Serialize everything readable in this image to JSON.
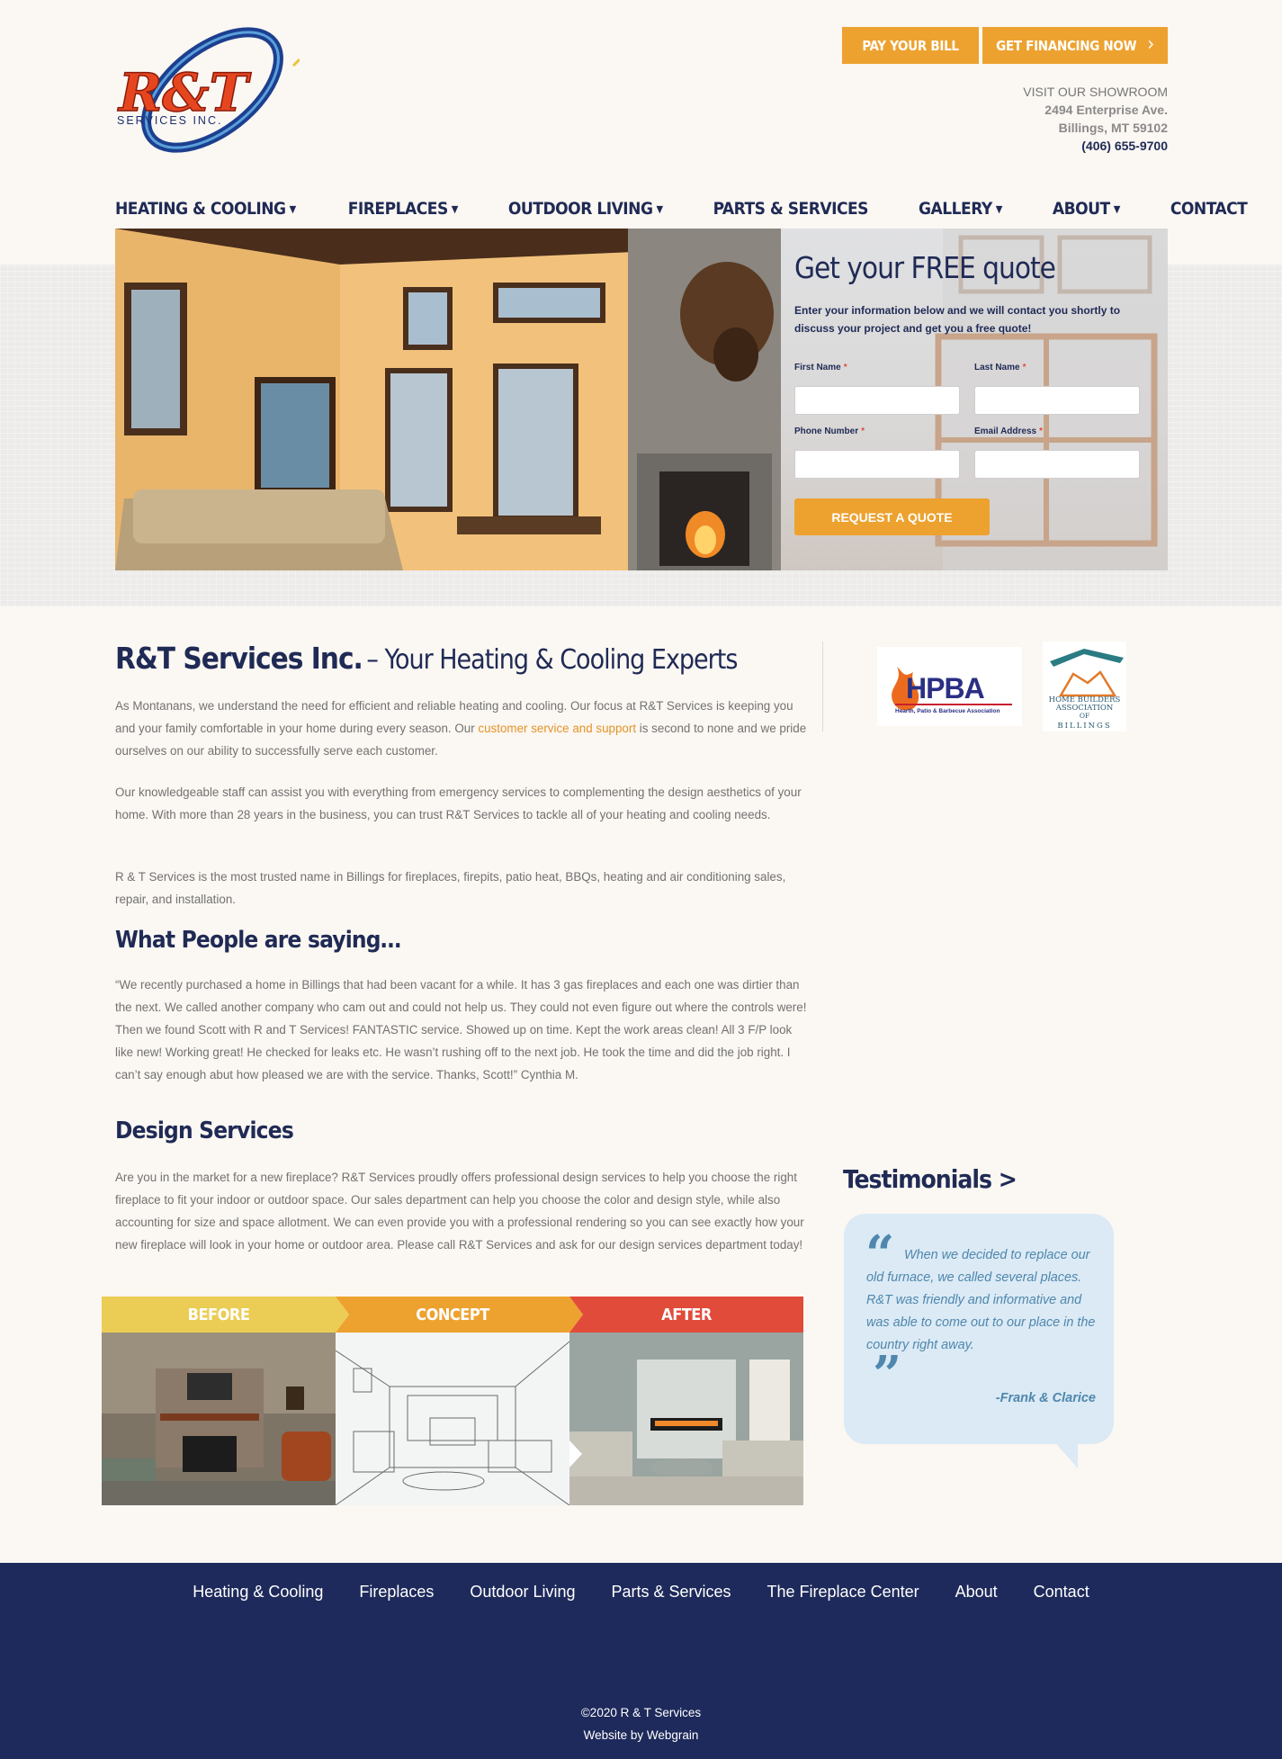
{
  "header": {
    "logo_text": "R&T",
    "logo_subtext": "SERVICES INC.",
    "pay_bill_label": "PAY YOUR BILL",
    "financing_label": "GET FINANCING NOW",
    "showroom": {
      "heading": "VISIT OUR SHOWROOM",
      "street": "2494 Enterprise Ave.",
      "city": "Billings, MT 59102",
      "phone": "(406) 655-9700"
    }
  },
  "nav": {
    "items": [
      {
        "label": "HEATING & COOLING",
        "dropdown": true
      },
      {
        "label": "FIREPLACES",
        "dropdown": true
      },
      {
        "label": "OUTDOOR LIVING",
        "dropdown": true
      },
      {
        "label": "PARTS & SERVICES",
        "dropdown": false
      },
      {
        "label": "GALLERY",
        "dropdown": true
      },
      {
        "label": "ABOUT",
        "dropdown": true
      },
      {
        "label": "CONTACT",
        "dropdown": false
      }
    ]
  },
  "quote_form": {
    "title": "Get your FREE quote",
    "description": "Enter your information below and we will contact you shortly to discuss your project and get you a free quote!",
    "fields": {
      "first_name": "First Name",
      "last_name": "Last Name",
      "phone": "Phone Number",
      "email": "Email Address"
    },
    "required_mark": "*",
    "submit_label": "REQUEST A QUOTE"
  },
  "main": {
    "title_strong": "R&T Services Inc.",
    "title_light": "– Your Heating & Cooling Experts",
    "p1_before": "As Montanans, we understand the need for efficient and reliable heating and cooling. Our focus at R&T Services is keeping you and your family comfortable in your home during every season. Our ",
    "p1_link": "customer service and support",
    "p1_after": " is second to none and we pride ourselves on our ability to successfully serve each customer.",
    "p2": "Our knowledgeable staff can assist you with everything from emergency services to complementing the design aesthetics of your home. With more than 28 years in the business, you can trust R&T Services to tackle all of your heating and cooling needs.",
    "p3": "R & T Services is the most trusted name in Billings for fireplaces, firepits, patio heat, BBQs,  heating and air conditioning sales, repair, and installation.",
    "reviews_heading": "What People are saying…",
    "review_text": "“We recently purchased a home in Billings that had been vacant for a while. It has 3 gas fireplaces and each one was dirtier than the next. We called another company who cam out and could not help us. They could not even figure out where the controls were! Then we found Scott with R and T Services! FANTASTIC service. Showed up on time. Kept the work areas clean! All 3 F/P look like new! Working great! He checked for leaks etc. He wasn’t rushing off to the next job. He took the time and did the job right. I can’t say enough abut how pleased we are with the service. Thanks, Scott!” Cynthia M.",
    "design_heading": "Design Services",
    "design_text": "Are you in the market for a new fireplace? R&T Services proudly offers professional design services to help you choose the right fireplace to fit your indoor or outdoor space. Our sales department can help you choose the color and design style, while also accounting for size and space allotment. We can even provide you with a professional rendering so you can see exactly how your new fireplace will look in your home or outdoor area. Please call R&T Services and ask for our design services department today!",
    "stages": [
      {
        "label": "BEFORE",
        "color": "#ebcd55"
      },
      {
        "label": "CONCEPT",
        "color": "#eda230"
      },
      {
        "label": "AFTER",
        "color": "#e14b3a"
      }
    ]
  },
  "sidebar": {
    "hpba_text": "HPBA",
    "hpba_caption": "Hearth, Patio & Barbecue Association",
    "hba_line1": "HOME BUILDERS",
    "hba_line2": "ASSOCIATION",
    "hba_line3": "OF",
    "hba_line4": "BILLINGS",
    "testimonials_heading": "Testimonials >",
    "testimonial_text": "When we decided to replace our old furnace, we called several places. R&T was friendly and informative and was able to come out to our place in the country right away.",
    "testimonial_author": "-Frank & Clarice"
  },
  "footer": {
    "links": [
      "Heating & Cooling",
      "Fireplaces",
      "Outdoor Living",
      "Parts & Services",
      "The Fireplace Center",
      "About",
      "Contact"
    ],
    "copyright": "©2020 R & T Services",
    "credit": "Website by Webgrain"
  },
  "colors": {
    "navy": "#1f2a55",
    "orange": "#eda230",
    "footer_bg": "#1e2a5b",
    "testimonial_bg": "#dbeaf5"
  }
}
